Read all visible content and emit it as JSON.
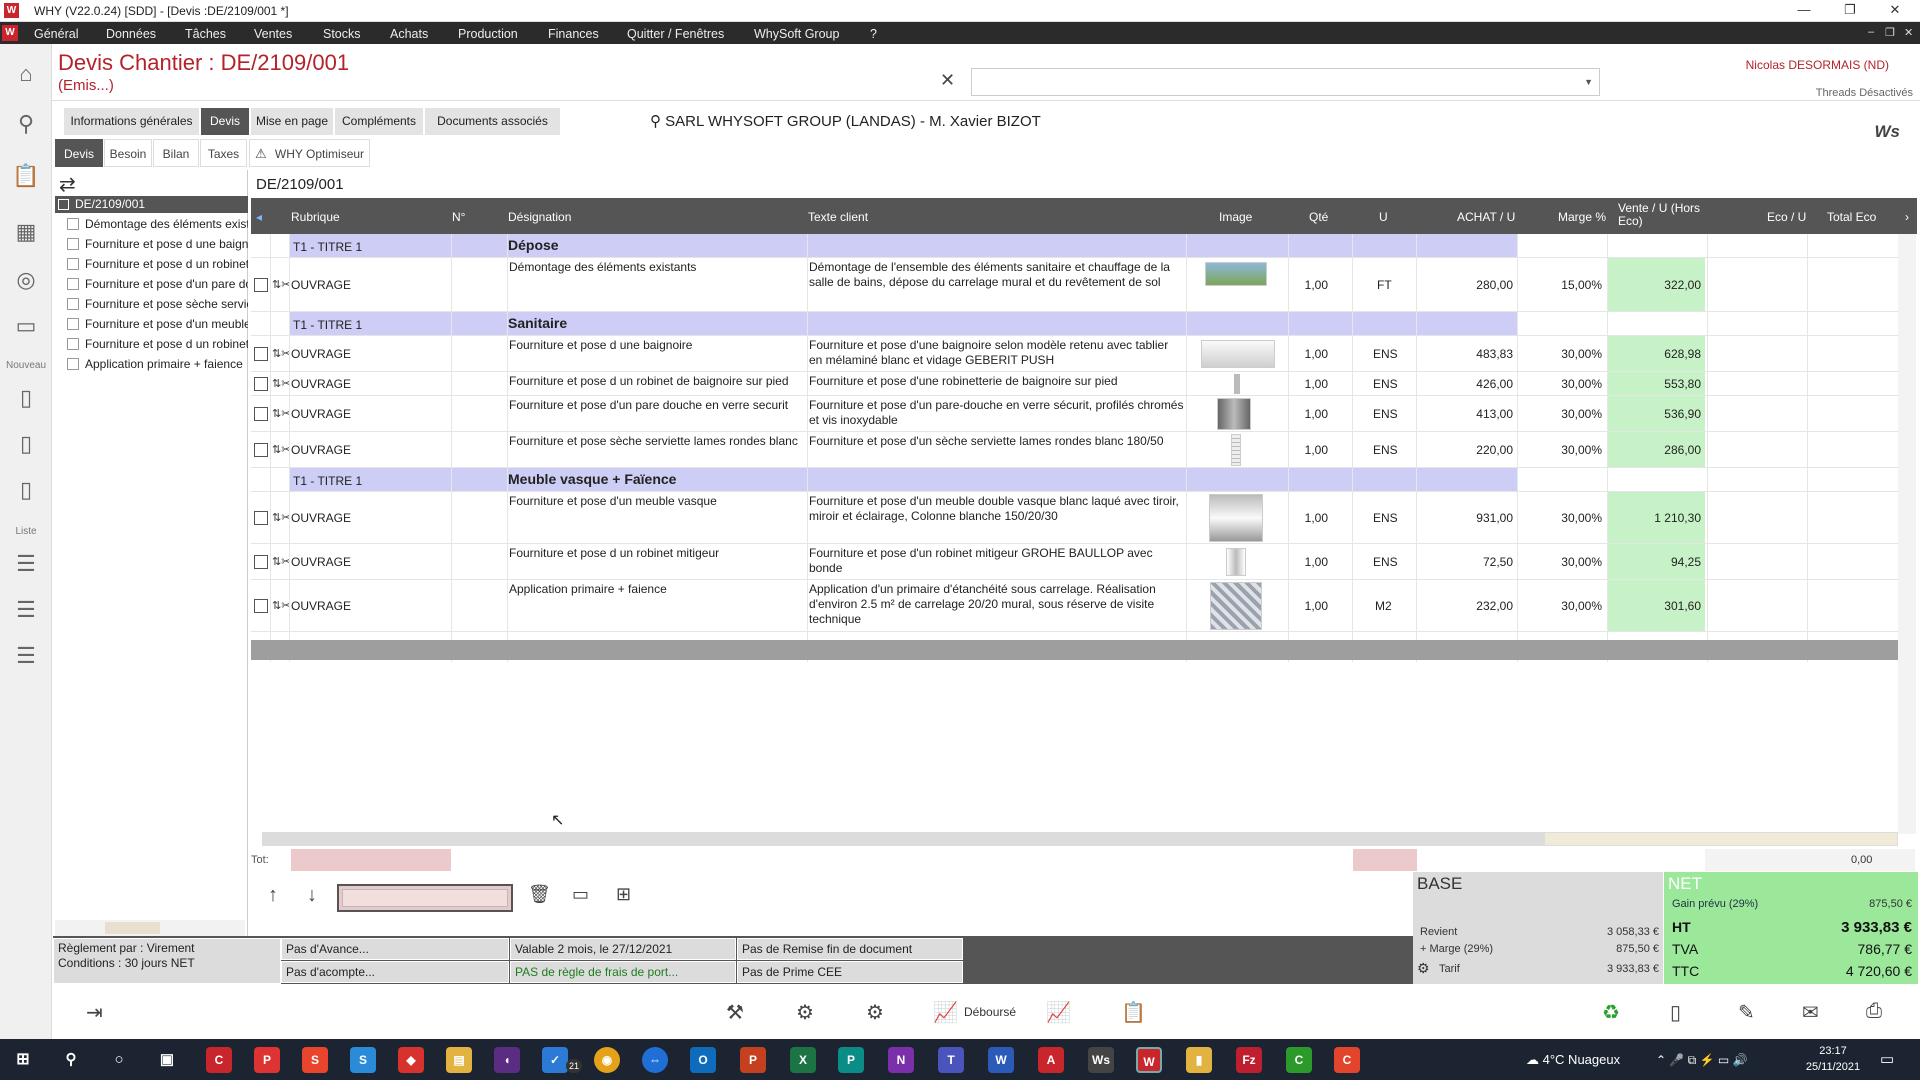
{
  "window": {
    "title": "WHY (V22.0.24)  [SDD] - [Devis :DE/2109/001 *]",
    "app_logo": "W",
    "controls": [
      "—",
      "❐",
      "✕"
    ]
  },
  "menu": {
    "items": [
      "Général",
      "Données",
      "Tâches",
      "Ventes",
      "Stocks",
      "Achats",
      "Production",
      "Finances",
      "Quitter / Fenêtres",
      "WhySoft Group",
      "?"
    ],
    "mdi_controls": [
      "–",
      "❐",
      "✕"
    ]
  },
  "leftbar": {
    "section_new": "Nouveau",
    "section_list": "Liste"
  },
  "header": {
    "title": "Devis  Chantier : DE/2109/001",
    "status": "(Emis...)",
    "close_symbol": "✕",
    "user": "Nicolas DESORMAIS (ND)",
    "threads": "Threads Désactivés"
  },
  "tabs_main": [
    "Informations générales",
    "Devis",
    "Mise en page",
    "Compléments",
    "Documents associés"
  ],
  "tabs_sub": [
    "Devis",
    "Besoin",
    "Bilan",
    "Taxes",
    "WHY Optimiseur"
  ],
  "client": "SARL WHYSOFT GROUP  (LANDAS) - M. Xavier BIZOT",
  "brand_logo": "Ws",
  "tree": {
    "root": "DE/2109/001",
    "items": [
      "Démontage des éléments existants",
      "Fourniture et pose d une baignoire",
      "Fourniture et pose d un robinet",
      "Fourniture et pose d'un pare douche",
      "Fourniture et pose sèche serviette",
      "Fourniture et pose d'un meuble",
      "Fourniture et pose d un robinet",
      "Application primaire + faience"
    ]
  },
  "doc_ref": "DE/2109/001",
  "grid": {
    "headers": {
      "rubrique": "Rubrique",
      "num": "N°",
      "designation": "Désignation",
      "texte": "Texte client",
      "image": "Image",
      "qte": "Qté",
      "u": "U",
      "achat": "ACHAT / U",
      "marge": "Marge %",
      "vente": "Vente / U (Hors Eco)",
      "eco": "Eco / U",
      "total_eco": "Total Eco"
    },
    "sections": [
      {
        "label": "T1 - TITRE 1",
        "title": "Dépose",
        "rows": [
          {
            "rubrique": "OUVRAGE",
            "designation": "Démontage des éléments existants",
            "texte": "Démontage de l'ensemble des éléments sanitaire et chauffage de la salle de bains, dépose du carrelage mural et du revêtement de sol",
            "qte": "1,00",
            "u": "FT",
            "achat": "280,00",
            "marge": "15,00%",
            "vente": "322,00"
          }
        ]
      },
      {
        "label": "T1 - TITRE 1",
        "title": "Sanitaire",
        "rows": [
          {
            "rubrique": "OUVRAGE",
            "designation": "Fourniture et pose d une baignoire",
            "texte": "Fourniture et pose d'une baignoire selon modèle retenu avec tablier en mélaminé blanc et vidage GEBERIT PUSH",
            "qte": "1,00",
            "u": "ENS",
            "achat": "483,83",
            "marge": "30,00%",
            "vente": "628,98"
          },
          {
            "rubrique": "OUVRAGE",
            "designation": "Fourniture et pose d un robinet de baignoire sur pied",
            "texte": "Fourniture et pose d'une robinetterie de baignoire sur pied",
            "qte": "1,00",
            "u": "ENS",
            "achat": "426,00",
            "marge": "30,00%",
            "vente": "553,80"
          },
          {
            "rubrique": "OUVRAGE",
            "designation": "Fourniture et pose d'un pare douche en verre securit",
            "texte": "Fourniture et pose d'un pare-douche en verre sécurit, profilés chromés et vis inoxydable",
            "qte": "1,00",
            "u": "ENS",
            "achat": "413,00",
            "marge": "30,00%",
            "vente": "536,90"
          },
          {
            "rubrique": "OUVRAGE",
            "designation": "Fourniture et pose sèche serviette lames rondes blanc",
            "texte": "Fourniture et pose d'un sèche serviette lames rondes blanc 180/50",
            "qte": "1,00",
            "u": "ENS",
            "achat": "220,00",
            "marge": "30,00%",
            "vente": "286,00"
          }
        ]
      },
      {
        "label": "T1 - TITRE 1",
        "title": "Meuble vasque + Faïence",
        "rows": [
          {
            "rubrique": "OUVRAGE",
            "designation": "Fourniture et pose d'un meuble vasque",
            "texte": "Fourniture et pose d'un meuble double vasque blanc laqué avec tiroir, miroir et éclairage, Colonne blanche 150/20/30",
            "qte": "1,00",
            "u": "ENS",
            "achat": "931,00",
            "marge": "30,00%",
            "vente": "1 210,30"
          },
          {
            "rubrique": "OUVRAGE",
            "designation": "Fourniture et pose d un robinet mitigeur",
            "texte": "Fourniture et pose d'un robinet mitigeur GROHE BAULLOP avec bonde",
            "qte": "1,00",
            "u": "ENS",
            "achat": "72,50",
            "marge": "30,00%",
            "vente": "94,25"
          },
          {
            "rubrique": "OUVRAGE",
            "designation": "Application primaire + faience",
            "texte": "Application d'un primaire d'étanchéité sous carrelage. Réalisation d'environ 2.5 m² de carrelage 20/20 mural, sous réserve de visite technique",
            "qte": "1,00",
            "u": "M2",
            "achat": "232,00",
            "marge": "30,00%",
            "vente": "301,60"
          }
        ]
      }
    ],
    "tot_label": "Tot:",
    "tot_value": "0,00"
  },
  "base": {
    "title": "BASE",
    "revient_label": "Revient",
    "revient": "3 058,33 €",
    "marge_label": "+ Marge (29%)",
    "marge": "875,50 €",
    "tarif_label": "Tarif",
    "tarif": "3 933,83 €"
  },
  "net": {
    "title": "NET",
    "gain_label": "Gain prévu (29%)",
    "gain": "875,50 €",
    "ht_label": "HT",
    "ht": "3 933,83 €",
    "tva_label": "TVA",
    "tva": "786,77 €",
    "ttc_label": "TTC",
    "ttc": "4 720,60 €"
  },
  "conditions": {
    "reglement": "Règlement par : Virement",
    "delai": "Conditions : 30 jours NET",
    "avance": "Pas d'Avance...",
    "acompte": "Pas d'acompte...",
    "validite": "Valable 2 mois, le 27/12/2021",
    "frais_port": "PAS de règle de frais de port...",
    "remise": "Pas de Remise fin de document",
    "prime": "Pas de Prime CEE"
  },
  "bottom_toolbar": {
    "debourse": "Déboursé"
  },
  "taskbar": {
    "weather": "4°C  Nuageux",
    "time": "23:17",
    "date": "25/11/2021",
    "badge": "21"
  },
  "colors": {
    "accent": "#b3232b",
    "title_band": "#cdcdf5",
    "vente_cell": "#c7f2c7",
    "net_panel": "#9be89b"
  }
}
